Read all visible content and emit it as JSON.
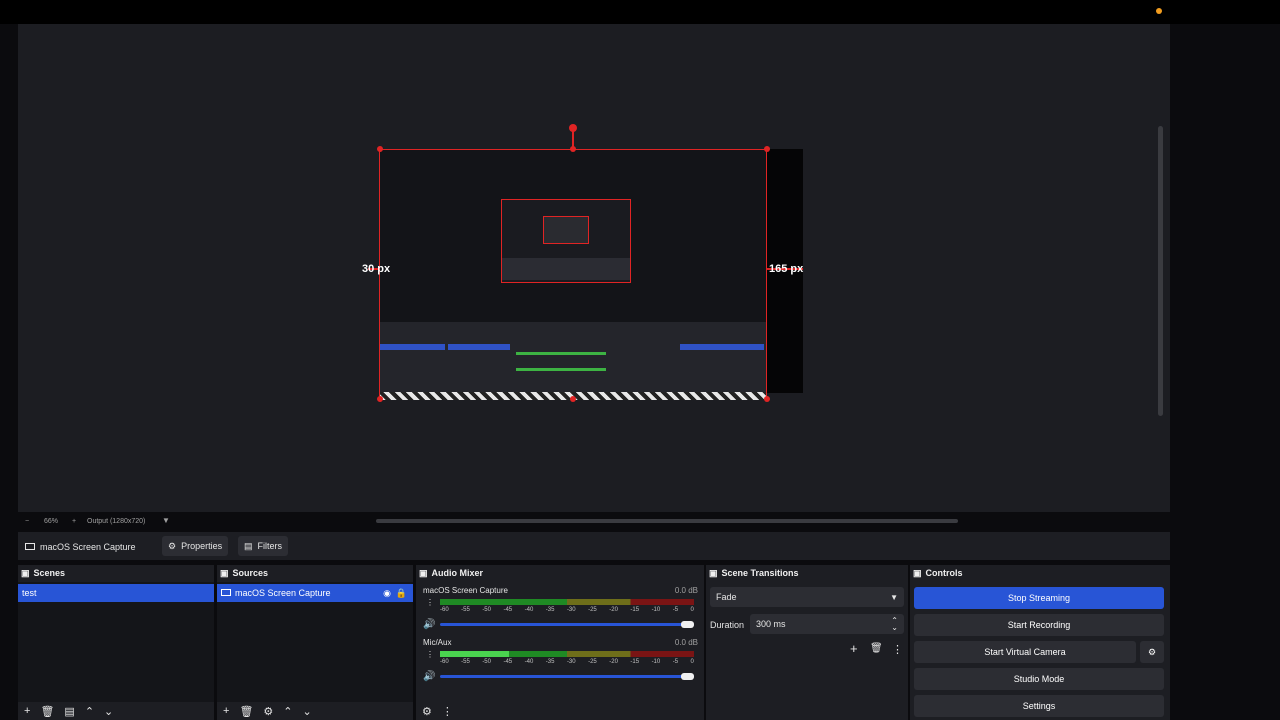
{
  "preview": {
    "left_measure": "30 px",
    "right_measure": "165 px"
  },
  "status": {
    "zoom_minus": "−",
    "zoom_level": "66%",
    "zoom_plus": "+",
    "output": "Output (1280x720)"
  },
  "propbar": {
    "source_name": "macOS Screen Capture",
    "properties_label": "Properties",
    "filters_label": "Filters"
  },
  "scenes": {
    "title": "Scenes",
    "items": [
      "test"
    ]
  },
  "sources": {
    "title": "Sources",
    "items": [
      "macOS Screen Capture"
    ]
  },
  "mixer": {
    "title": "Audio Mixer",
    "channels": [
      {
        "name": "macOS Screen Capture",
        "db": "0.0 dB",
        "level": 0.0
      },
      {
        "name": "Mic/Aux",
        "db": "0.0 dB",
        "level": 0.27
      }
    ],
    "ticks": [
      "-60",
      "-55",
      "-50",
      "-45",
      "-40",
      "-35",
      "-30",
      "-25",
      "-20",
      "-15",
      "-10",
      "-5",
      "0"
    ]
  },
  "transitions": {
    "title": "Scene Transitions",
    "selected": "Fade",
    "duration_label": "Duration",
    "duration_value": "300 ms"
  },
  "controls": {
    "title": "Controls",
    "buttons": [
      "Stop Streaming",
      "Start Recording",
      "Start Virtual Camera",
      "Studio Mode",
      "Settings"
    ]
  },
  "colors": {
    "accent": "#2855d6",
    "selection": "#e02424",
    "recording_dot": "#f29d1f"
  }
}
